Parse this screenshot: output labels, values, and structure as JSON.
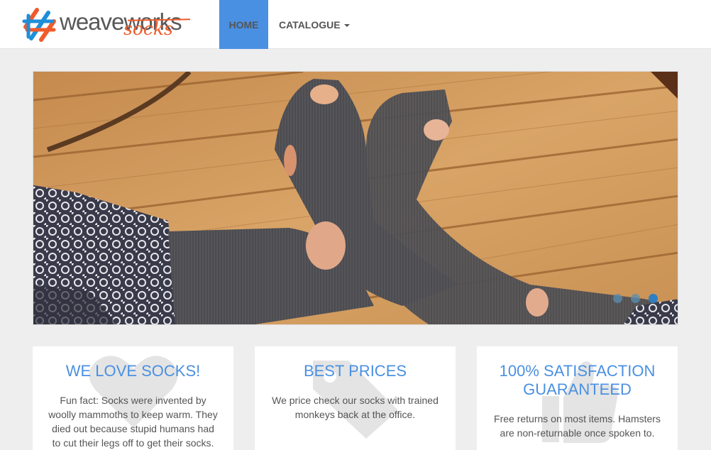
{
  "brand": {
    "word": "weaveworks",
    "sub": "socks",
    "colors": {
      "orange": "#ef5b2b",
      "blue": "#1f8ed8",
      "gray": "#585858"
    }
  },
  "nav": {
    "home_label": "HOME",
    "catalogue_label": "CATALOGUE",
    "active_color": "#4a90e2"
  },
  "carousel": {
    "slide_count": 3,
    "active_index": 2
  },
  "features": [
    {
      "title": "WE LOVE SOCKS!",
      "text": "Fun fact: Socks were invented by woolly mammoths to keep warm. They died out because stupid humans had to cut their legs off to get their socks.",
      "icon": "heart-icon"
    },
    {
      "title": "BEST PRICES",
      "text": "We price check our socks with trained monkeys back at the office.",
      "icon": "price-tag-icon"
    },
    {
      "title": "100% SATISFACTION GUARANTEED",
      "text": "Free returns on most items. Hamsters are non-returnable once spoken to.",
      "icon": "thumbs-up-icon"
    }
  ]
}
